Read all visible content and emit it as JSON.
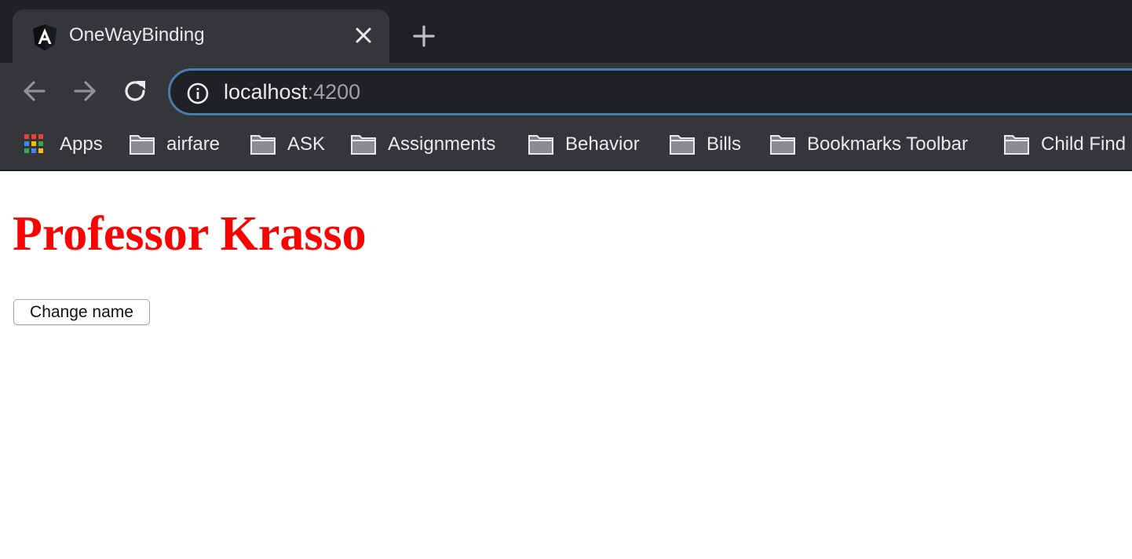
{
  "browser": {
    "tab": {
      "title": "OneWayBinding",
      "favicon": "angular-logo-icon"
    },
    "toolbar": {
      "back_icon": "arrow-left-icon",
      "forward_icon": "arrow-right-icon",
      "reload_icon": "reload-icon",
      "address": {
        "host": "localhost",
        "port": ":4200",
        "info_icon": "info-icon"
      }
    },
    "bookmarks": [
      {
        "label": "Apps",
        "icon": "apps-grid-icon"
      },
      {
        "label": "airfare",
        "icon": "folder-icon"
      },
      {
        "label": "ASK",
        "icon": "folder-icon"
      },
      {
        "label": "Assignments",
        "icon": "folder-icon"
      },
      {
        "label": "Behavior",
        "icon": "folder-icon"
      },
      {
        "label": "Bills",
        "icon": "folder-icon"
      },
      {
        "label": "Bookmarks Toolbar",
        "icon": "folder-icon"
      },
      {
        "label": "Child Find",
        "icon": "folder-icon"
      }
    ]
  },
  "page": {
    "heading": "Professor Krasso",
    "change_button_label": "Change name"
  },
  "colors": {
    "tabstrip": "#202124",
    "toolbar": "#35363a",
    "omnibox_border": "#4a7bab",
    "heading": "#ff0000"
  }
}
